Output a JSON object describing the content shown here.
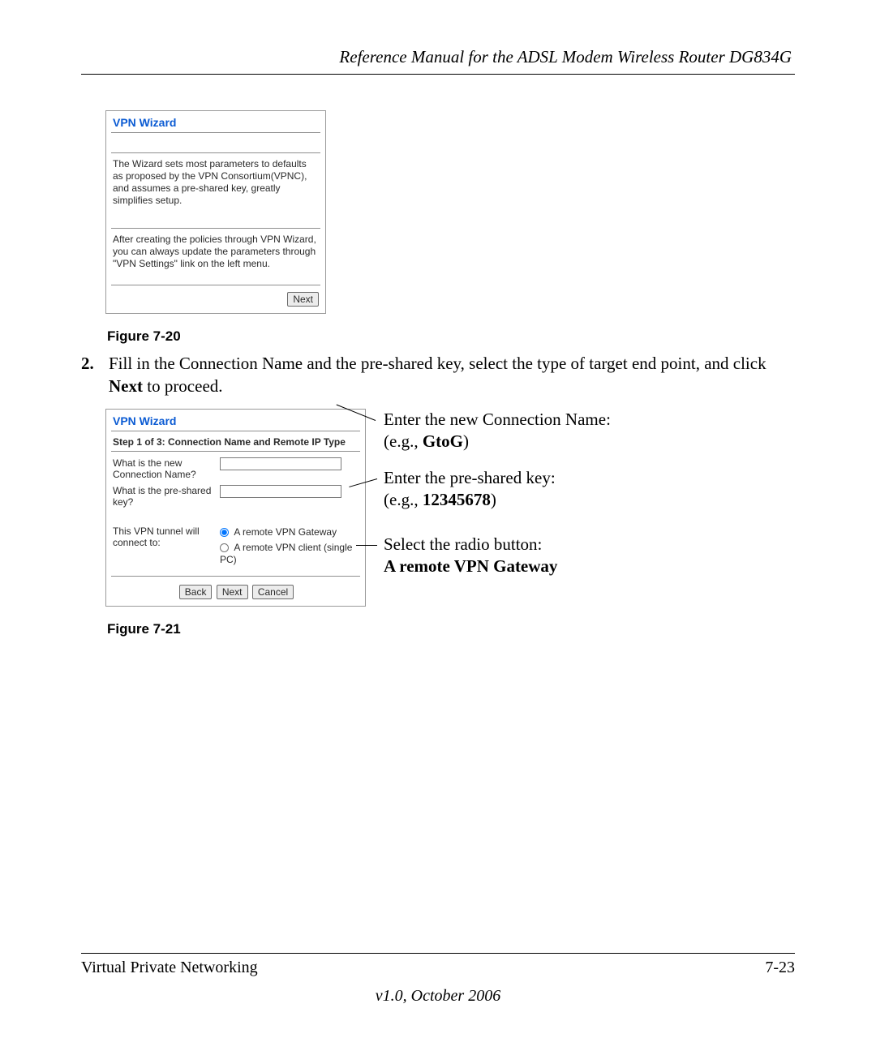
{
  "header": {
    "title": "Reference Manual for the ADSL Modem Wireless Router DG834G"
  },
  "wizard1": {
    "title": "VPN Wizard",
    "para1": "The Wizard sets most parameters to defaults as proposed by the VPN Consortium(VPNC), and assumes a pre-shared key, greatly simplifies setup.",
    "para2": "After creating the policies through VPN Wizard, you can always update the parameters through \"VPN Settings\" link on the left menu.",
    "next": "Next"
  },
  "fig20": "Figure 7-20",
  "step2": {
    "num": "2.",
    "text_a": "Fill in the Connection Name and the pre-shared key, select the type of target end point, and click ",
    "text_bold": "Next",
    "text_b": " to proceed."
  },
  "wizard2": {
    "title": "VPN Wizard",
    "step": "Step 1 of 3: Connection Name and Remote IP Type",
    "q_name": "What is the new Connection Name?",
    "q_key": "What is the pre-shared key?",
    "q_tunnel": "This VPN tunnel will connect to:",
    "radio_gateway": "A remote VPN Gateway",
    "radio_client": "A remote VPN client (single PC)",
    "back": "Back",
    "next": "Next",
    "cancel": "Cancel"
  },
  "callouts": {
    "c1a": "Enter the new Connection Name:",
    "c1b_a": "(e.g., ",
    "c1b_bold": "GtoG",
    "c1b_b": ")",
    "c2a": "Enter the pre-shared key:",
    "c2b_a": "(e.g., ",
    "c2b_bold": "12345678",
    "c2b_b": ")",
    "c3a": "Select the radio button:",
    "c3b": "A remote VPN Gateway"
  },
  "fig21": "Figure 7-21",
  "footer": {
    "left": "Virtual Private Networking",
    "right": "7-23",
    "version": "v1.0, October 2006"
  }
}
